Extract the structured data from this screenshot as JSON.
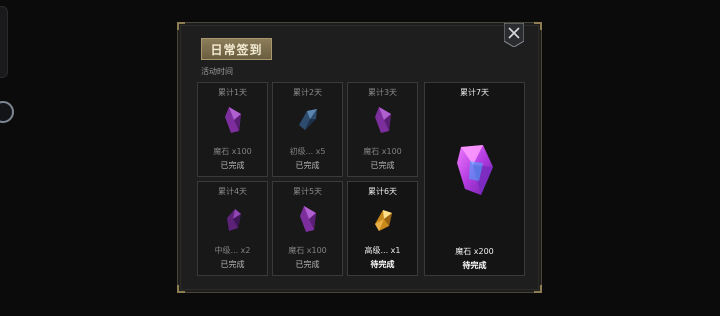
{
  "panel": {
    "title": "日常签到",
    "subtitle": "活动时间"
  },
  "cards": [
    {
      "day": "累计1天",
      "reward": "魔石 x100",
      "status": "已完成",
      "gem": "purple-crystal",
      "state": "done"
    },
    {
      "day": "累计2天",
      "reward": "初级... x5",
      "status": "已完成",
      "gem": "blue-crystal",
      "state": "done"
    },
    {
      "day": "累计3天",
      "reward": "魔石 x100",
      "status": "已完成",
      "gem": "purple-crystal",
      "state": "done"
    },
    {
      "day": "累计4天",
      "reward": "中级... x2",
      "status": "已完成",
      "gem": "dark-purple-crystal",
      "state": "done"
    },
    {
      "day": "累计5天",
      "reward": "魔石 x100",
      "status": "已完成",
      "gem": "purple-crystal",
      "state": "done"
    },
    {
      "day": "累计6天",
      "reward": "高级... x1",
      "status": "待完成",
      "gem": "gold-crystal",
      "state": "pending"
    },
    {
      "day": "累计7天",
      "reward": "魔石 x200",
      "status": "待完成",
      "gem": "large-purple-crystal",
      "state": "pending"
    }
  ],
  "colors": {
    "gold_accent": "#8e7d52",
    "panel_bg": "#1e1e1f",
    "card_bg": "#141415"
  }
}
